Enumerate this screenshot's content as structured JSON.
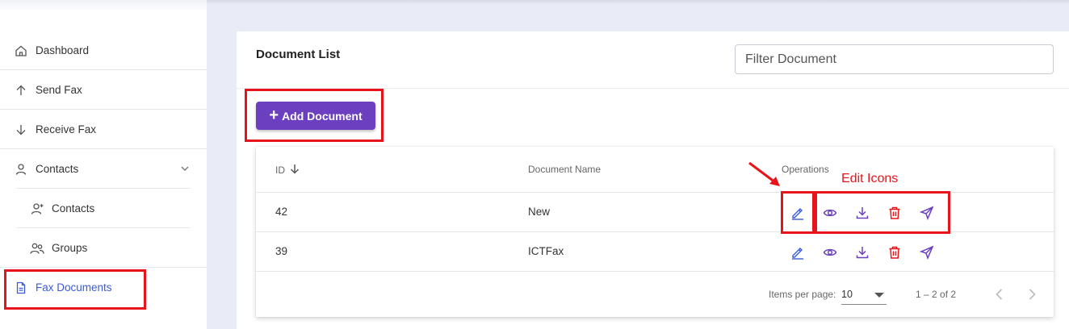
{
  "sidebar": {
    "items": [
      {
        "label": "Dashboard",
        "icon": "home-icon"
      },
      {
        "label": "Send Fax",
        "icon": "arrow-up-icon"
      },
      {
        "label": "Receive Fax",
        "icon": "arrow-down-icon"
      },
      {
        "label": "Contacts",
        "icon": "user-icon"
      },
      {
        "label": "Contacts",
        "icon": "user-plus-icon"
      },
      {
        "label": "Groups",
        "icon": "users-icon"
      },
      {
        "label": "Fax Documents",
        "icon": "document-icon"
      }
    ]
  },
  "main": {
    "title": "Document List",
    "filter_placeholder": "Filter Document",
    "add_button_label": "Add Document",
    "table": {
      "columns": [
        "ID",
        "Document Name",
        "Operations"
      ],
      "rows": [
        {
          "id": "42",
          "name": "New"
        },
        {
          "id": "39",
          "name": "ICTFax"
        }
      ],
      "operations": [
        "edit-icon",
        "view-icon",
        "download-icon",
        "delete-icon",
        "send-icon"
      ]
    },
    "paginator": {
      "items_per_page_label": "Items per page:",
      "page_size": "10",
      "range_label": "1 – 2 of 2"
    }
  },
  "annotation": {
    "label": "Edit Icons",
    "color": "#e8141b"
  },
  "colors": {
    "accent": "#6b3fbf",
    "active_nav": "#3a5bd9",
    "edit_icon": "#3a5bd9",
    "op_icon": "#6b3fbf",
    "delete_icon": "#e8141b"
  }
}
